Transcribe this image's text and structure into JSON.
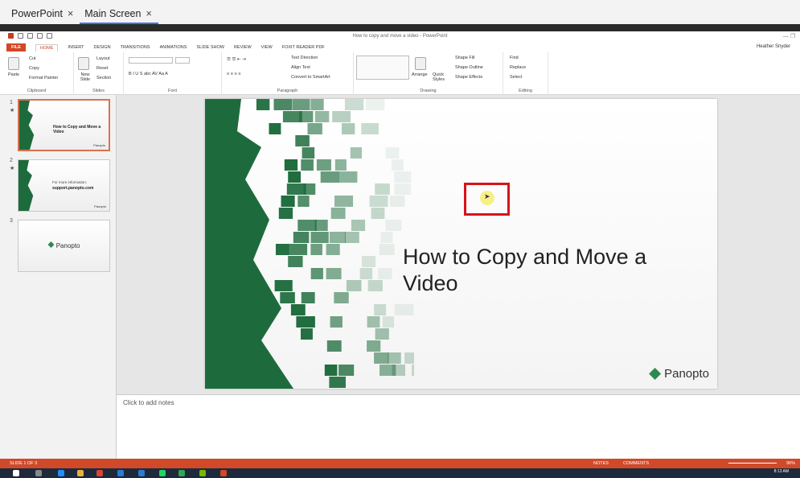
{
  "outer_tabs": [
    {
      "label": "PowerPoint",
      "close": "×"
    },
    {
      "label": "Main Screen",
      "close": "×"
    }
  ],
  "window": {
    "doc_title": "How to copy and move a video - PowerPoint",
    "user": "Heather Snyder"
  },
  "ribbon_tabs": [
    "FILE",
    "HOME",
    "INSERT",
    "DESIGN",
    "TRANSITIONS",
    "ANIMATIONS",
    "SLIDE SHOW",
    "REVIEW",
    "VIEW",
    "FOXIT READER PDF"
  ],
  "clipboard": {
    "paste": "Paste",
    "cut": "Cut",
    "copy": "Copy",
    "format_painter": "Format Painter",
    "label": "Clipboard"
  },
  "slides_group": {
    "new_slide": "New Slide",
    "layout": "Layout",
    "reset": "Reset",
    "section": "Section",
    "label": "Slides"
  },
  "font_group": {
    "label": "Font",
    "letters": "B I U S abc AV Aa A"
  },
  "paragraph_group": {
    "text_direction": "Text Direction",
    "align_text": "Align Text",
    "convert_smartart": "Convert to SmartArt",
    "label": "Paragraph"
  },
  "drawing_group": {
    "arrange": "Arrange",
    "quick_styles": "Quick Styles",
    "shape_fill": "Shape Fill",
    "shape_outline": "Shape Outline",
    "shape_effects": "Shape Effects",
    "label": "Drawing"
  },
  "editing_group": {
    "find": "Find",
    "replace": "Replace",
    "select": "Select",
    "label": "Editing"
  },
  "thumbnails": [
    {
      "number": "1",
      "star": "★",
      "title": "How to Copy and Move a Video",
      "brand": "Panopto"
    },
    {
      "number": "2",
      "star": "★",
      "sub1": "For more information:",
      "sub2": "support.panopto.com",
      "brand": "Panopto"
    },
    {
      "number": "3",
      "center": "Panopto"
    }
  ],
  "slide": {
    "title": "How to Copy and Move a Video",
    "brand": "Panopto"
  },
  "notes": {
    "placeholder": "Click to add notes"
  },
  "status": {
    "slide_count": "SLIDE 1 OF 3",
    "notes": "NOTES",
    "comments": "COMMENTS",
    "zoom": "96%"
  },
  "taskbar": {
    "time": "8:13 AM"
  },
  "colors": {
    "accent": "#d24726",
    "slide_green": "#1d6b3c",
    "highlight": "#d8121a",
    "taskbar": "#1c2a3c"
  }
}
